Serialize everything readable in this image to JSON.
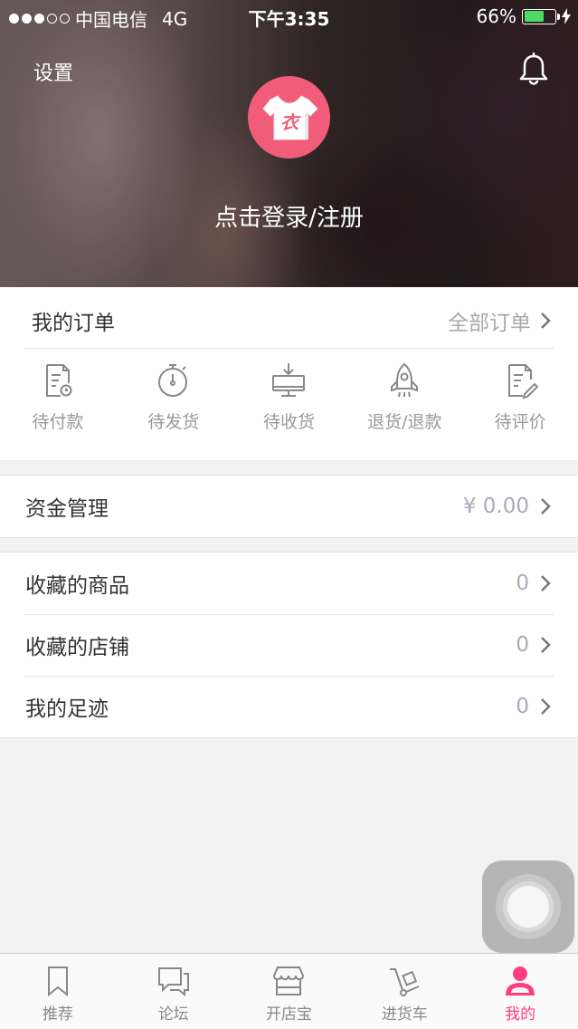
{
  "status_bar": {
    "carrier": "中国电信",
    "network": "4G",
    "time": "下午3:35",
    "battery": "66%",
    "battery_level": 0.66,
    "battery_color": "#4cd964"
  },
  "header": {
    "settings_label": "设置",
    "bell_icon": "bell-icon",
    "avatar_icon": "tshirt-logo-icon",
    "avatar_color": "#f15d78",
    "login_label": "点击登录/注册"
  },
  "orders": {
    "title": "我的订单",
    "all_label": "全部订单",
    "items": [
      {
        "label": "待付款",
        "icon": "pending-payment-icon"
      },
      {
        "label": "待发货",
        "icon": "stopwatch-icon"
      },
      {
        "label": "待收货",
        "icon": "receive-box-icon"
      },
      {
        "label": "退货/退款",
        "icon": "rocket-icon"
      },
      {
        "label": "待评价",
        "icon": "review-edit-icon"
      }
    ]
  },
  "funds": {
    "label": "资金管理",
    "value": "¥ 0.00"
  },
  "favorites": [
    {
      "label": "收藏的商品",
      "value": "0"
    },
    {
      "label": "收藏的店铺",
      "value": "0"
    },
    {
      "label": "我的足迹",
      "value": "0"
    }
  ],
  "tabbar": {
    "active_color": "#ff3d7f",
    "items": [
      {
        "label": "推荐",
        "icon": "bookmark-icon"
      },
      {
        "label": "论坛",
        "icon": "chat-bubbles-icon"
      },
      {
        "label": "开店宝",
        "icon": "storefront-icon"
      },
      {
        "label": "进货车",
        "icon": "hand-truck-icon"
      },
      {
        "label": "我的",
        "icon": "person-icon",
        "active": true
      }
    ]
  }
}
